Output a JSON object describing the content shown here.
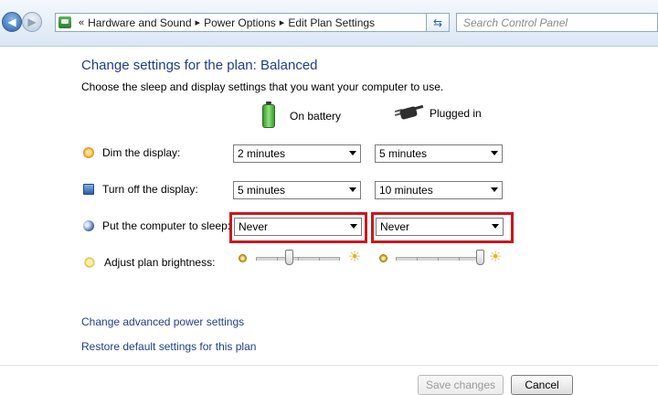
{
  "nav": {
    "breadcrumbs": [
      "Hardware and Sound",
      "Power Options",
      "Edit Plan Settings"
    ],
    "overflow": "«",
    "search_placeholder": "Search Control Panel"
  },
  "page": {
    "title": "Change settings for the plan: Balanced",
    "subtitle": "Choose the sleep and display settings that you want your computer to use."
  },
  "columns": {
    "battery": "On battery",
    "plugged": "Plugged in"
  },
  "rows": {
    "dim": {
      "label": "Dim the display:",
      "battery": "2 minutes",
      "plugged": "5 minutes",
      "icon": "dim-display-icon"
    },
    "off": {
      "label": "Turn off the display:",
      "battery": "5 minutes",
      "plugged": "10 minutes",
      "icon": "monitor-icon"
    },
    "sleep": {
      "label": "Put the computer to sleep:",
      "battery": "Never",
      "plugged": "Never",
      "icon": "sleep-icon"
    },
    "brightness": {
      "label": "Adjust plan brightness:",
      "battery_level": 0.4,
      "plugged_level": 1.0,
      "icon": "brightness-icon"
    }
  },
  "links": {
    "advanced": "Change advanced power settings",
    "restore": "Restore default settings for this plan"
  },
  "buttons": {
    "save": "Save changes",
    "cancel": "Cancel"
  },
  "colors": {
    "highlight": "#c8181e",
    "link": "#1e3e8a"
  }
}
